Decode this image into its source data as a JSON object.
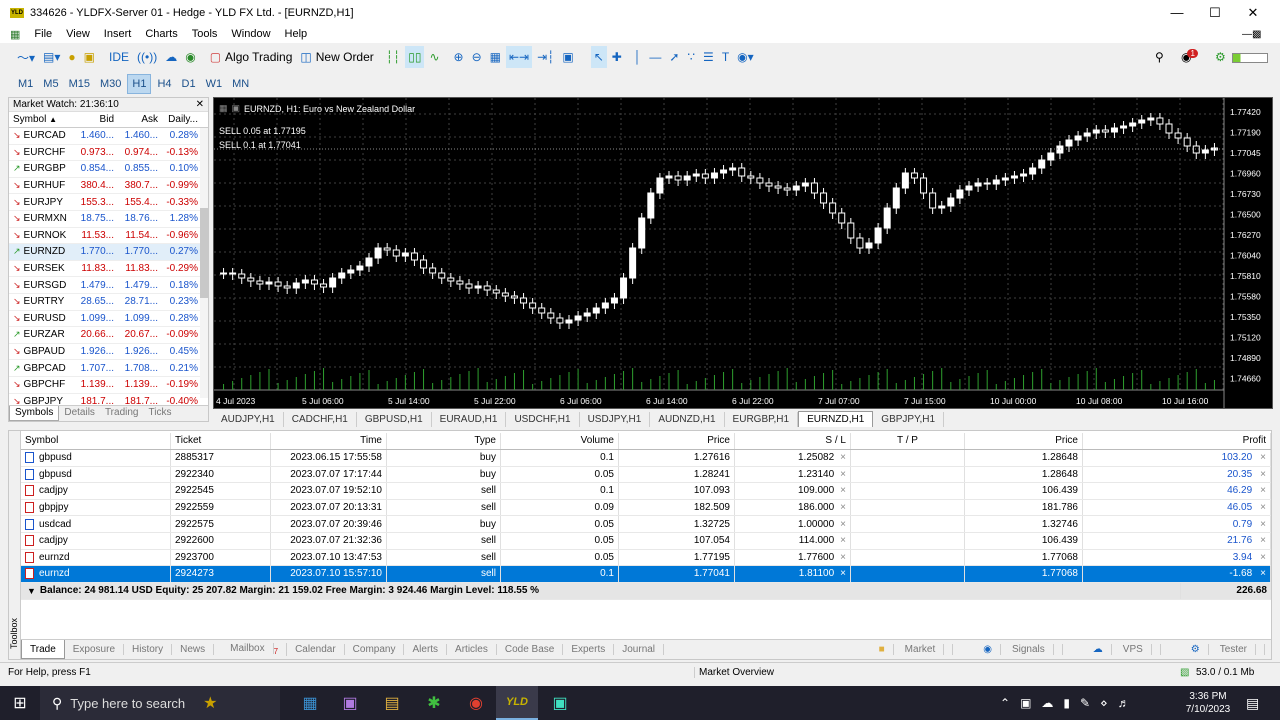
{
  "window": {
    "title": "334626 - YLDFX-Server 01 - Hedge - YLD FX Ltd. - [EURNZD,H1]",
    "logo": "YLD"
  },
  "menu": [
    "File",
    "View",
    "Insert",
    "Charts",
    "Tools",
    "Window",
    "Help"
  ],
  "toolbar": {
    "ide": "IDE",
    "algo": "Algo Trading",
    "new_order": "New Order",
    "notif_count": "1"
  },
  "timeframes": [
    "M1",
    "M5",
    "M15",
    "M30",
    "H1",
    "H4",
    "D1",
    "W1",
    "MN"
  ],
  "active_tf": "H1",
  "market_watch": {
    "title": "Market Watch: 21:36:10",
    "headers": [
      "Symbol",
      "Bid",
      "Ask",
      "Daily..."
    ],
    "rows": [
      {
        "s": "EURCAD",
        "b": "1.460...",
        "a": "1.460...",
        "d": "0.28%",
        "dir": "down",
        "pos": true
      },
      {
        "s": "EURCHF",
        "b": "0.973...",
        "a": "0.974...",
        "d": "-0.13%",
        "dir": "down",
        "pos": false
      },
      {
        "s": "EURGBP",
        "b": "0.854...",
        "a": "0.855...",
        "d": "0.10%",
        "dir": "up",
        "pos": true
      },
      {
        "s": "EURHUF",
        "b": "380.4...",
        "a": "380.7...",
        "d": "-0.99%",
        "dir": "down",
        "pos": false
      },
      {
        "s": "EURJPY",
        "b": "155.3...",
        "a": "155.4...",
        "d": "-0.33%",
        "dir": "down",
        "pos": false
      },
      {
        "s": "EURMXN",
        "b": "18.75...",
        "a": "18.76...",
        "d": "1.28%",
        "dir": "down",
        "pos": true
      },
      {
        "s": "EURNOK",
        "b": "11.53...",
        "a": "11.54...",
        "d": "-0.96%",
        "dir": "down",
        "pos": false
      },
      {
        "s": "EURNZD",
        "b": "1.770...",
        "a": "1.770...",
        "d": "0.27%",
        "dir": "up",
        "pos": true,
        "sel": true
      },
      {
        "s": "EURSEK",
        "b": "11.83...",
        "a": "11.83...",
        "d": "-0.29%",
        "dir": "down",
        "pos": false
      },
      {
        "s": "EURSGD",
        "b": "1.479...",
        "a": "1.479...",
        "d": "0.18%",
        "dir": "down",
        "pos": true
      },
      {
        "s": "EURTRY",
        "b": "28.65...",
        "a": "28.71...",
        "d": "0.23%",
        "dir": "down",
        "pos": true
      },
      {
        "s": "EURUSD",
        "b": "1.099...",
        "a": "1.099...",
        "d": "0.28%",
        "dir": "down",
        "pos": true
      },
      {
        "s": "EURZAR",
        "b": "20.66...",
        "a": "20.67...",
        "d": "-0.09%",
        "dir": "up",
        "pos": false
      },
      {
        "s": "GBPAUD",
        "b": "1.926...",
        "a": "1.926...",
        "d": "0.45%",
        "dir": "down",
        "pos": true
      },
      {
        "s": "GBPCAD",
        "b": "1.707...",
        "a": "1.708...",
        "d": "0.21%",
        "dir": "up",
        "pos": true
      },
      {
        "s": "GBPCHF",
        "b": "1.139...",
        "a": "1.139...",
        "d": "-0.19%",
        "dir": "down",
        "pos": false
      },
      {
        "s": "GBPJPY",
        "b": "181.7...",
        "a": "181.7...",
        "d": "-0.40%",
        "dir": "down",
        "pos": false
      }
    ],
    "tabs": [
      "Symbols",
      "Details",
      "Trading",
      "Ticks"
    ]
  },
  "chart": {
    "header": "EURNZD, H1:  Euro vs New Zealand Dollar",
    "sell1": "SELL 0.05 at 1.77195",
    "sell2": "SELL 0.1 at 1.77041",
    "price_labels": [
      "1.77420",
      "1.77190",
      "1.77045",
      "1.76960",
      "1.76730",
      "1.76500",
      "1.76270",
      "1.76040",
      "1.75810",
      "1.75580",
      "1.75350",
      "1.75120",
      "1.74890",
      "1.74660"
    ],
    "time_labels": [
      "4 Jul 2023",
      "5 Jul 06:00",
      "5 Jul 14:00",
      "5 Jul 22:00",
      "6 Jul 06:00",
      "6 Jul 14:00",
      "6 Jul 22:00",
      "7 Jul 07:00",
      "7 Jul 15:00",
      "10 Jul 00:00",
      "10 Jul 08:00",
      "10 Jul 16:00"
    ]
  },
  "chart_tabs": [
    "AUDJPY,H1",
    "CADCHF,H1",
    "GBPUSD,H1",
    "EURAUD,H1",
    "USDCHF,H1",
    "USDJPY,H1",
    "AUDNZD,H1",
    "EURGBP,H1",
    "EURNZD,H1",
    "GBPJPY,H1"
  ],
  "active_chart_tab": "EURNZD,H1",
  "trade": {
    "headers": [
      "Symbol",
      "Ticket",
      "Time",
      "Type",
      "Volume",
      "Price",
      "S / L",
      "T / P",
      "Price",
      "Profit"
    ],
    "rows": [
      {
        "sym": "gbpusd",
        "ticket": "2885317",
        "time": "2023.06.15 17:55:58",
        "type": "buy",
        "vol": "0.1",
        "price": "1.27616",
        "sl": "1.25082",
        "tp": "",
        "cur": "1.28648",
        "profit": "103.20",
        "color": "#1a55cc"
      },
      {
        "sym": "gbpusd",
        "ticket": "2922340",
        "time": "2023.07.07 17:17:44",
        "type": "buy",
        "vol": "0.05",
        "price": "1.28241",
        "sl": "1.23140",
        "tp": "",
        "cur": "1.28648",
        "profit": "20.35",
        "color": "#1a55cc"
      },
      {
        "sym": "cadjpy",
        "ticket": "2922545",
        "time": "2023.07.07 19:52:10",
        "type": "sell",
        "vol": "0.1",
        "price": "107.093",
        "sl": "109.000",
        "tp": "",
        "cur": "106.439",
        "profit": "46.29",
        "color": "#1a55cc"
      },
      {
        "sym": "gbpjpy",
        "ticket": "2922559",
        "time": "2023.07.07 20:13:31",
        "type": "sell",
        "vol": "0.09",
        "price": "182.509",
        "sl": "186.000",
        "tp": "",
        "cur": "181.786",
        "profit": "46.05",
        "color": "#1a55cc"
      },
      {
        "sym": "usdcad",
        "ticket": "2922575",
        "time": "2023.07.07 20:39:46",
        "type": "buy",
        "vol": "0.05",
        "price": "1.32725",
        "sl": "1.00000",
        "tp": "",
        "cur": "1.32746",
        "profit": "0.79",
        "color": "#1a55cc"
      },
      {
        "sym": "cadjpy",
        "ticket": "2922600",
        "time": "2023.07.07 21:32:36",
        "type": "sell",
        "vol": "0.05",
        "price": "107.054",
        "sl": "114.000",
        "tp": "",
        "cur": "106.439",
        "profit": "21.76",
        "color": "#1a55cc"
      },
      {
        "sym": "eurnzd",
        "ticket": "2923700",
        "time": "2023.07.10 13:47:53",
        "type": "sell",
        "vol": "0.05",
        "price": "1.77195",
        "sl": "1.77600",
        "tp": "",
        "cur": "1.77068",
        "profit": "3.94",
        "color": "#1a55cc"
      },
      {
        "sym": "eurnzd",
        "ticket": "2924273",
        "time": "2023.07.10 15:57:10",
        "type": "sell",
        "vol": "0.1",
        "price": "1.77041",
        "sl": "1.81100",
        "tp": "",
        "cur": "1.77068",
        "profit": "-1.68",
        "color": "#ffffff",
        "sel": true
      }
    ],
    "balance": "Balance: 24 981.14 USD  Equity: 25 207.82  Margin: 21 159.02  Free Margin: 3 924.46  Margin Level: 118.55 %",
    "total": "226.68"
  },
  "toolbox_label": "Toolbox",
  "toolbox_tabs": [
    "Trade",
    "Exposure",
    "History",
    "News",
    "Mailbox",
    "Calendar",
    "Company",
    "Alerts",
    "Articles",
    "Code Base",
    "Experts",
    "Journal"
  ],
  "mailbox_count": "7",
  "toolbox_right": [
    "Market",
    "Signals",
    "VPS",
    "Tester"
  ],
  "status": {
    "help": "For Help, press F1",
    "overview": "Market Overview",
    "net": "53.0 / 0.1 Mb"
  },
  "taskbar": {
    "search": "Type here to search",
    "time": "3:36 PM",
    "date": "7/10/2023",
    "yld": "YLD"
  },
  "colors": {
    "pos": "#1a55cc",
    "neg": "#cc0000",
    "bg_chart": "#000000",
    "bull": "#ffffff",
    "bear": "#000000"
  }
}
